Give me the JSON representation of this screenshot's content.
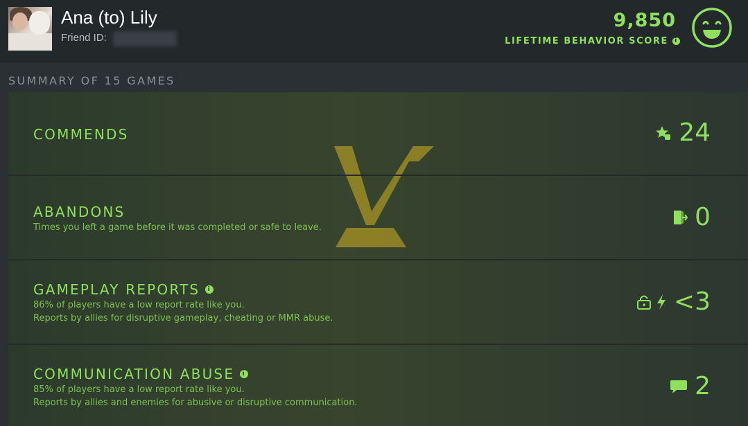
{
  "header": {
    "player_name": "Ana (to) Lily",
    "friend_id_label": "Friend ID:",
    "score": "9,850",
    "score_label": "LIFETIME BEHAVIOR SCORE"
  },
  "summary": {
    "title": "SUMMARY OF 15 GAMES"
  },
  "rows": [
    {
      "title": "COMMENDS",
      "desc1": "",
      "desc2": "",
      "value": "24",
      "icon": "star-thumb-icon",
      "has_info": false
    },
    {
      "title": "ABANDONS",
      "desc1": "Times you left a game before it was completed or safe to leave.",
      "desc2": "",
      "value": "0",
      "icon": "exit-door-icon",
      "has_info": false
    },
    {
      "title": "GAMEPLAY REPORTS",
      "desc1": "86% of players have a low report rate like you.",
      "desc2": "Reports by allies for disruptive gameplay, cheating or MMR abuse.",
      "value": "<3",
      "icon": "lock-lightning-icon",
      "has_info": true
    },
    {
      "title": "COMMUNICATION ABUSE",
      "desc1": "85% of players have a low report rate like you.",
      "desc2": "Reports by allies and enemies for abusive or disruptive communication.",
      "value": "2",
      "icon": "chat-bubble-icon",
      "has_info": true
    }
  ],
  "colors": {
    "accent": "#8fe05c",
    "header_bg": "#23282b",
    "page_bg": "#2a3034",
    "watermark": "#b39a2a"
  }
}
